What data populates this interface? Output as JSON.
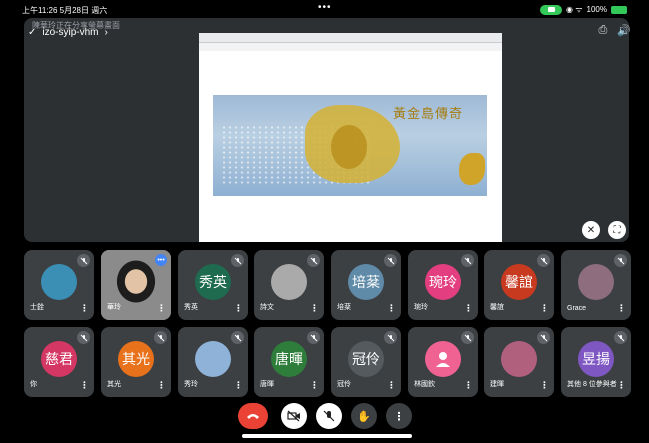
{
  "status": {
    "time_date": "上午11:26  5月28日 週六",
    "dots": "•••",
    "battery": "100%"
  },
  "meeting": {
    "hint": "陳華玲正在分享螢幕畫面",
    "code": "izo-syip-vhm",
    "painting_title": "黃金島傳奇"
  },
  "participants_row1": [
    {
      "name": "士銓",
      "initials": "",
      "color": "#3b8fb4",
      "kind": "photo"
    },
    {
      "name": "華玲",
      "initials": "",
      "color": "#777777",
      "kind": "video"
    },
    {
      "name": "秀英",
      "initials": "秀英",
      "color": "#1e6b4f",
      "kind": "initials"
    },
    {
      "name": "詩文",
      "initials": "",
      "color": "#aaaaaa",
      "kind": "photo"
    },
    {
      "name": "培棻",
      "initials": "培棻",
      "color": "#5f8aa8",
      "kind": "initials"
    },
    {
      "name": "琬玲",
      "initials": "琬玲",
      "color": "#e33e7f",
      "kind": "initials"
    },
    {
      "name": "馨誼",
      "initials": "馨誼",
      "color": "#c73a1f",
      "kind": "initials"
    },
    {
      "name": "Grace",
      "initials": "",
      "color": "#8e6e7e",
      "kind": "photo"
    }
  ],
  "participants_row2": [
    {
      "name": "你",
      "initials": "慈君",
      "color": "#d43763",
      "kind": "initials"
    },
    {
      "name": "其光",
      "initials": "其光",
      "color": "#e8711b",
      "kind": "initials"
    },
    {
      "name": "秀玲",
      "initials": "",
      "color": "#8fb3d8",
      "kind": "photo"
    },
    {
      "name": "唐暉",
      "initials": "唐暉",
      "color": "#2f7d3a",
      "kind": "initials"
    },
    {
      "name": "冠伶",
      "initials": "冠伶",
      "color": "#555a5f",
      "kind": "initials"
    },
    {
      "name": "林國欽",
      "initials": "",
      "color": "#f06292",
      "kind": "person"
    },
    {
      "name": "建暉",
      "initials": "",
      "color": "#b0607c",
      "kind": "photo"
    },
    {
      "name": "其他 8 位參與者",
      "initials": "昱揚",
      "color": "#7e57c2",
      "kind": "initials"
    }
  ],
  "controls": [
    "end-call",
    "camera-off",
    "mic-off",
    "raise-hand",
    "more"
  ]
}
